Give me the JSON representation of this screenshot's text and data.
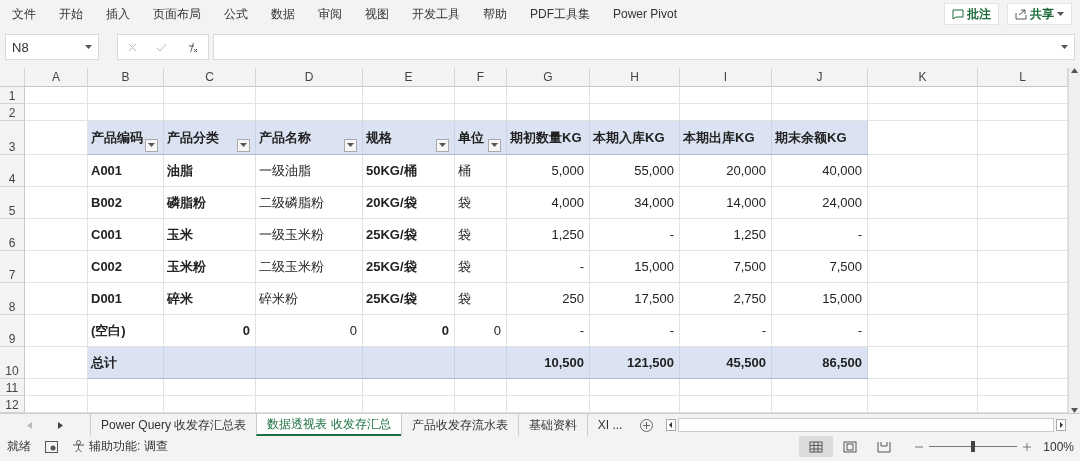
{
  "menu": {
    "items": [
      "文件",
      "开始",
      "插入",
      "页面布局",
      "公式",
      "数据",
      "审阅",
      "视图",
      "开发工具",
      "帮助",
      "PDF工具集",
      "Power Pivot"
    ],
    "comment_button": "批注",
    "share_button": "共享"
  },
  "formula_bar": {
    "name_box": "N8"
  },
  "sheet": {
    "columns": [
      "A",
      "B",
      "C",
      "D",
      "E",
      "F",
      "G",
      "H",
      "I",
      "J",
      "K",
      "L"
    ],
    "rows": [
      {
        "number": "1",
        "kind": "empty"
      },
      {
        "number": "2",
        "kind": "empty"
      },
      {
        "number": "3",
        "kind": "header",
        "cells": [
          {
            "label": "产品编码",
            "filter": true
          },
          {
            "label": "产品分类",
            "filter": true
          },
          {
            "label": "产品名称",
            "filter": true
          },
          {
            "label": "规格",
            "filter": true
          },
          {
            "label": "单位",
            "filter": true
          },
          {
            "label": "期初数量KG",
            "filter": false
          },
          {
            "label": "本期入库KG",
            "filter": false
          },
          {
            "label": "本期出库KG",
            "filter": false
          },
          {
            "label": "期末余额KG",
            "filter": false
          }
        ]
      },
      {
        "number": "4",
        "kind": "data",
        "cells": [
          "A001",
          "油脂",
          "一级油脂",
          "50KG/桶",
          "桶",
          "5,000",
          "55,000",
          "20,000",
          "40,000"
        ]
      },
      {
        "number": "5",
        "kind": "data",
        "cells": [
          "B002",
          "磷脂粉",
          "二级磷脂粉",
          "20KG/袋",
          "袋",
          "4,000",
          "34,000",
          "14,000",
          "24,000"
        ]
      },
      {
        "number": "6",
        "kind": "data",
        "cells": [
          "C001",
          "玉米",
          "一级玉米粉",
          "25KG/袋",
          "袋",
          "1,250",
          "-",
          "1,250",
          "-"
        ]
      },
      {
        "number": "7",
        "kind": "data",
        "cells": [
          "C002",
          "玉米粉",
          "二级玉米粉",
          "25KG/袋",
          "袋",
          "-",
          "15,000",
          "7,500",
          "7,500"
        ]
      },
      {
        "number": "8",
        "kind": "data",
        "cells": [
          "D001",
          "碎米",
          "碎米粉",
          "25KG/袋",
          "袋",
          "250",
          "17,500",
          "2,750",
          "15,000"
        ]
      },
      {
        "number": "9",
        "kind": "blank_item",
        "cells": [
          "(空白)",
          "0",
          "0",
          "0",
          "0",
          "-",
          "-",
          "-",
          "-"
        ]
      },
      {
        "number": "10",
        "kind": "total",
        "cells": [
          "总计",
          "",
          "",
          "",
          "",
          "10,500",
          "121,500",
          "45,500",
          "86,500"
        ]
      },
      {
        "number": "11",
        "kind": "empty"
      },
      {
        "number": "12",
        "kind": "empty"
      }
    ]
  },
  "sheet_tabs": [
    {
      "label": "Power Query 收发存汇总表",
      "selected": false
    },
    {
      "label": "数据透视表 收发存汇总",
      "selected": true
    },
    {
      "label": "产品收发存流水表",
      "selected": false
    },
    {
      "label": "基础资料",
      "selected": false
    },
    {
      "label": "XI ...",
      "selected": false
    }
  ],
  "status_bar": {
    "status": "就绪",
    "accessibility": "辅助功能: 调查",
    "zoom": "100%",
    "zoom_slider": {
      "level": 0.5
    },
    "views": [
      {
        "kind": "normal",
        "selected": true
      },
      {
        "kind": "page_layout",
        "selected": false
      },
      {
        "kind": "page_break",
        "selected": false
      }
    ]
  }
}
